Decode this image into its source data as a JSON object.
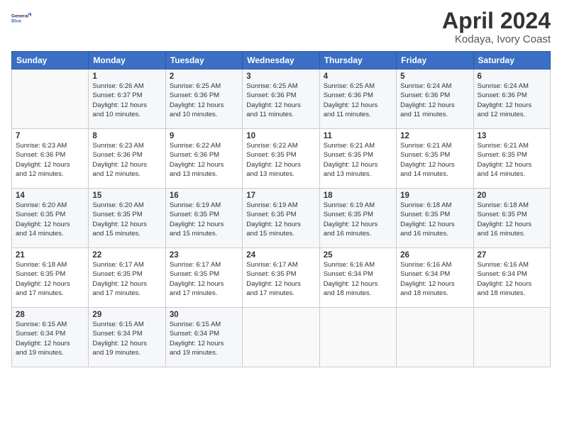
{
  "logo": {
    "line1": "General",
    "line2": "Blue"
  },
  "title": "April 2024",
  "subtitle": "Kodaya, Ivory Coast",
  "header": {
    "colors": {
      "header_bg": "#3a6fc4"
    }
  },
  "days_of_week": [
    "Sunday",
    "Monday",
    "Tuesday",
    "Wednesday",
    "Thursday",
    "Friday",
    "Saturday"
  ],
  "weeks": [
    [
      {
        "day": "",
        "info": ""
      },
      {
        "day": "1",
        "info": "Sunrise: 6:26 AM\nSunset: 6:37 PM\nDaylight: 12 hours\nand 10 minutes."
      },
      {
        "day": "2",
        "info": "Sunrise: 6:25 AM\nSunset: 6:36 PM\nDaylight: 12 hours\nand 10 minutes."
      },
      {
        "day": "3",
        "info": "Sunrise: 6:25 AM\nSunset: 6:36 PM\nDaylight: 12 hours\nand 11 minutes."
      },
      {
        "day": "4",
        "info": "Sunrise: 6:25 AM\nSunset: 6:36 PM\nDaylight: 12 hours\nand 11 minutes."
      },
      {
        "day": "5",
        "info": "Sunrise: 6:24 AM\nSunset: 6:36 PM\nDaylight: 12 hours\nand 11 minutes."
      },
      {
        "day": "6",
        "info": "Sunrise: 6:24 AM\nSunset: 6:36 PM\nDaylight: 12 hours\nand 12 minutes."
      }
    ],
    [
      {
        "day": "7",
        "info": "Sunrise: 6:23 AM\nSunset: 6:36 PM\nDaylight: 12 hours\nand 12 minutes."
      },
      {
        "day": "8",
        "info": "Sunrise: 6:23 AM\nSunset: 6:36 PM\nDaylight: 12 hours\nand 12 minutes."
      },
      {
        "day": "9",
        "info": "Sunrise: 6:22 AM\nSunset: 6:36 PM\nDaylight: 12 hours\nand 13 minutes."
      },
      {
        "day": "10",
        "info": "Sunrise: 6:22 AM\nSunset: 6:35 PM\nDaylight: 12 hours\nand 13 minutes."
      },
      {
        "day": "11",
        "info": "Sunrise: 6:21 AM\nSunset: 6:35 PM\nDaylight: 12 hours\nand 13 minutes."
      },
      {
        "day": "12",
        "info": "Sunrise: 6:21 AM\nSunset: 6:35 PM\nDaylight: 12 hours\nand 14 minutes."
      },
      {
        "day": "13",
        "info": "Sunrise: 6:21 AM\nSunset: 6:35 PM\nDaylight: 12 hours\nand 14 minutes."
      }
    ],
    [
      {
        "day": "14",
        "info": "Sunrise: 6:20 AM\nSunset: 6:35 PM\nDaylight: 12 hours\nand 14 minutes."
      },
      {
        "day": "15",
        "info": "Sunrise: 6:20 AM\nSunset: 6:35 PM\nDaylight: 12 hours\nand 15 minutes."
      },
      {
        "day": "16",
        "info": "Sunrise: 6:19 AM\nSunset: 6:35 PM\nDaylight: 12 hours\nand 15 minutes."
      },
      {
        "day": "17",
        "info": "Sunrise: 6:19 AM\nSunset: 6:35 PM\nDaylight: 12 hours\nand 15 minutes."
      },
      {
        "day": "18",
        "info": "Sunrise: 6:19 AM\nSunset: 6:35 PM\nDaylight: 12 hours\nand 16 minutes."
      },
      {
        "day": "19",
        "info": "Sunrise: 6:18 AM\nSunset: 6:35 PM\nDaylight: 12 hours\nand 16 minutes."
      },
      {
        "day": "20",
        "info": "Sunrise: 6:18 AM\nSunset: 6:35 PM\nDaylight: 12 hours\nand 16 minutes."
      }
    ],
    [
      {
        "day": "21",
        "info": "Sunrise: 6:18 AM\nSunset: 6:35 PM\nDaylight: 12 hours\nand 17 minutes."
      },
      {
        "day": "22",
        "info": "Sunrise: 6:17 AM\nSunset: 6:35 PM\nDaylight: 12 hours\nand 17 minutes."
      },
      {
        "day": "23",
        "info": "Sunrise: 6:17 AM\nSunset: 6:35 PM\nDaylight: 12 hours\nand 17 minutes."
      },
      {
        "day": "24",
        "info": "Sunrise: 6:17 AM\nSunset: 6:35 PM\nDaylight: 12 hours\nand 17 minutes."
      },
      {
        "day": "25",
        "info": "Sunrise: 6:16 AM\nSunset: 6:34 PM\nDaylight: 12 hours\nand 18 minutes."
      },
      {
        "day": "26",
        "info": "Sunrise: 6:16 AM\nSunset: 6:34 PM\nDaylight: 12 hours\nand 18 minutes."
      },
      {
        "day": "27",
        "info": "Sunrise: 6:16 AM\nSunset: 6:34 PM\nDaylight: 12 hours\nand 18 minutes."
      }
    ],
    [
      {
        "day": "28",
        "info": "Sunrise: 6:15 AM\nSunset: 6:34 PM\nDaylight: 12 hours\nand 19 minutes."
      },
      {
        "day": "29",
        "info": "Sunrise: 6:15 AM\nSunset: 6:34 PM\nDaylight: 12 hours\nand 19 minutes."
      },
      {
        "day": "30",
        "info": "Sunrise: 6:15 AM\nSunset: 6:34 PM\nDaylight: 12 hours\nand 19 minutes."
      },
      {
        "day": "",
        "info": ""
      },
      {
        "day": "",
        "info": ""
      },
      {
        "day": "",
        "info": ""
      },
      {
        "day": "",
        "info": ""
      }
    ]
  ]
}
